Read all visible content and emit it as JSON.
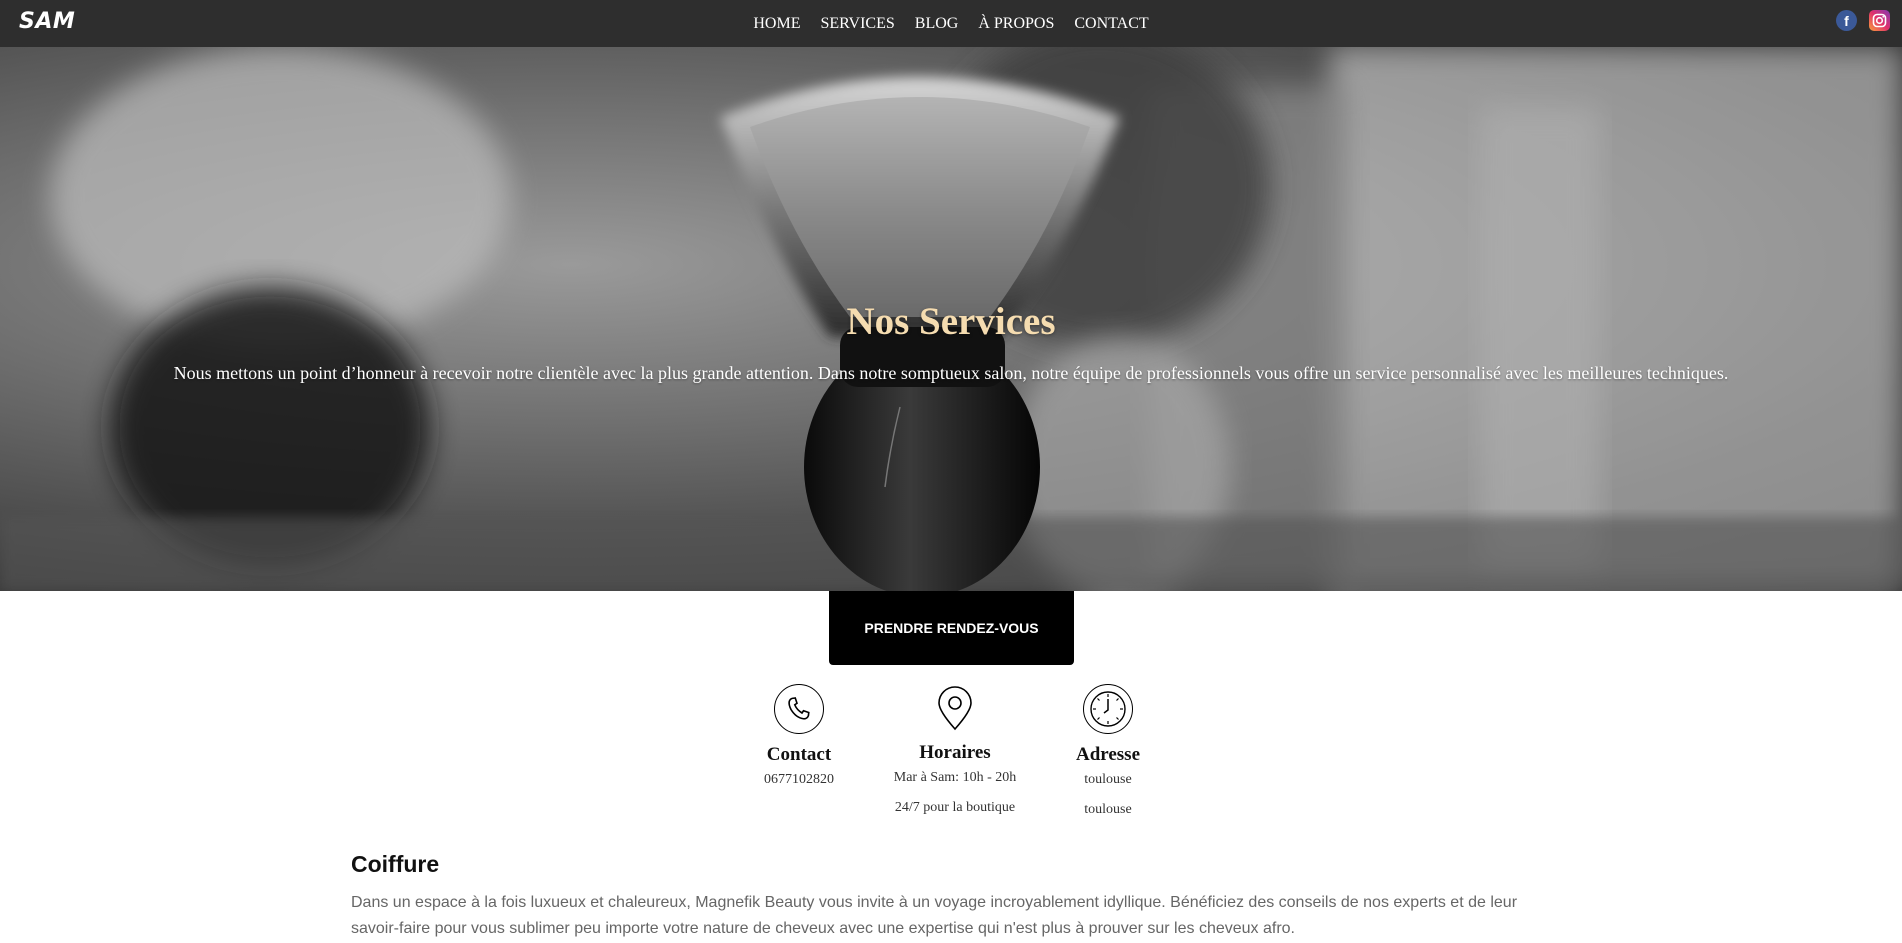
{
  "brand": {
    "logo": "SAM"
  },
  "nav": {
    "items": [
      "HOME",
      "SERVICES",
      "BLOG",
      "À PROPOS",
      "CONTACT"
    ],
    "social": [
      {
        "icon": "facebook-icon",
        "label": "f",
        "color": "#3b5998"
      },
      {
        "icon": "instagram-icon",
        "color": "#e1306c"
      }
    ]
  },
  "hero": {
    "title": "Nos Services",
    "subtitle": "Nous mettons un point d’honneur à recevoir notre clientèle avec la plus grande attention. Dans notre somptueux salon, notre équipe de professionnels vous offre un service personnalisé avec les meilleures techniques.",
    "image": "black-and-white-shaving-brush-photo"
  },
  "cta": {
    "label": "PRENDRE RENDEZ-VOUS"
  },
  "info": [
    {
      "icon": "phone-icon",
      "title": "Contact",
      "lines": [
        "0677102820"
      ]
    },
    {
      "icon": "location-pin-icon",
      "title": "Horaires",
      "lines": [
        "Mar à Sam: 10h - 20h",
        "24/7 pour la boutique"
      ]
    },
    {
      "icon": "clock-icon",
      "title": "Adresse",
      "lines": [
        "toulouse",
        "toulouse"
      ]
    }
  ],
  "section": {
    "title": "Coiffure",
    "text": "Dans un espace à la fois luxueux et chaleureux, Magnefik Beauty vous invite à un voyage incroyablement idyllique. Bénéficiez des conseils de nos experts et de leur savoir-faire pour vous sublimer peu importe votre nature de cheveux avec une expertise qui n'est plus à prouver sur les cheveux afro."
  },
  "colors": {
    "topbar": "#2e2e2e",
    "hero_title": "#f5dcb0",
    "cta_bg": "#000000"
  }
}
